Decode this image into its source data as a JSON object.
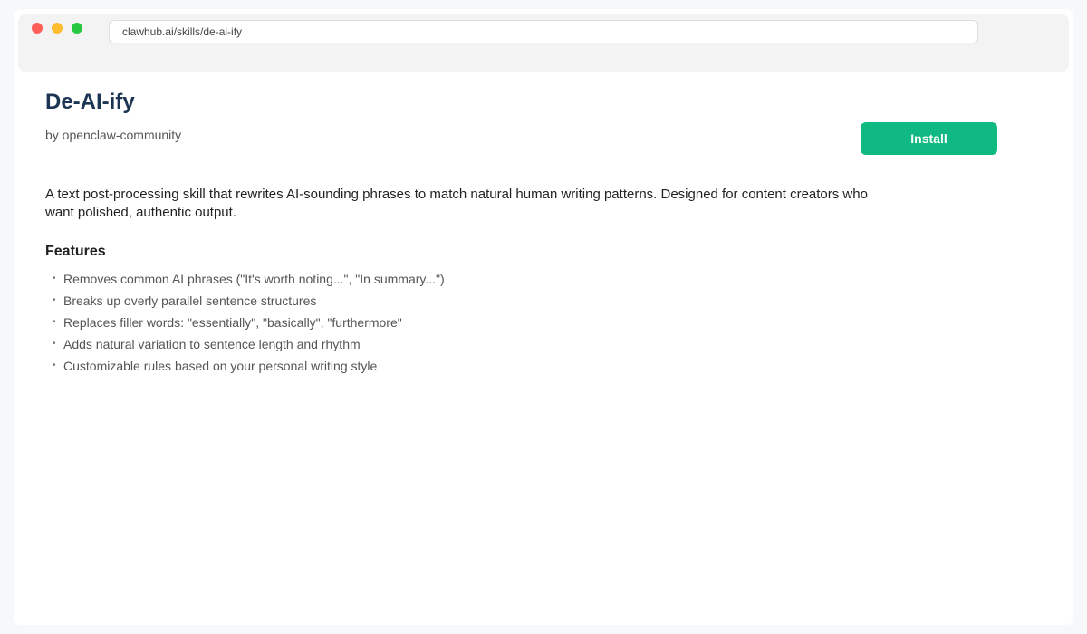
{
  "browser": {
    "url": "clawhub.ai/skills/de-ai-ify",
    "controls": {
      "close_color": "#ff5f57",
      "minimize_color": "#febc2e",
      "maximize_color": "#28c840"
    }
  },
  "skill": {
    "title": "De-AI-ify",
    "author": "by openclaw-community",
    "install_label": "Install",
    "accent_color": "#10b981",
    "description": "A text post-processing skill that rewrites AI-sounding phrases to match natural human writing patterns. Designed for content creators who want polished, authentic output.",
    "features_heading": "Features",
    "features": [
      "Removes common AI phrases (\"It's worth noting...\", \"In summary...\")",
      "Breaks up overly parallel sentence structures",
      "Replaces filler words: \"essentially\", \"basically\", \"furthermore\"",
      "Adds natural variation to sentence length and rhythm",
      "Customizable rules based on your personal writing style"
    ]
  }
}
